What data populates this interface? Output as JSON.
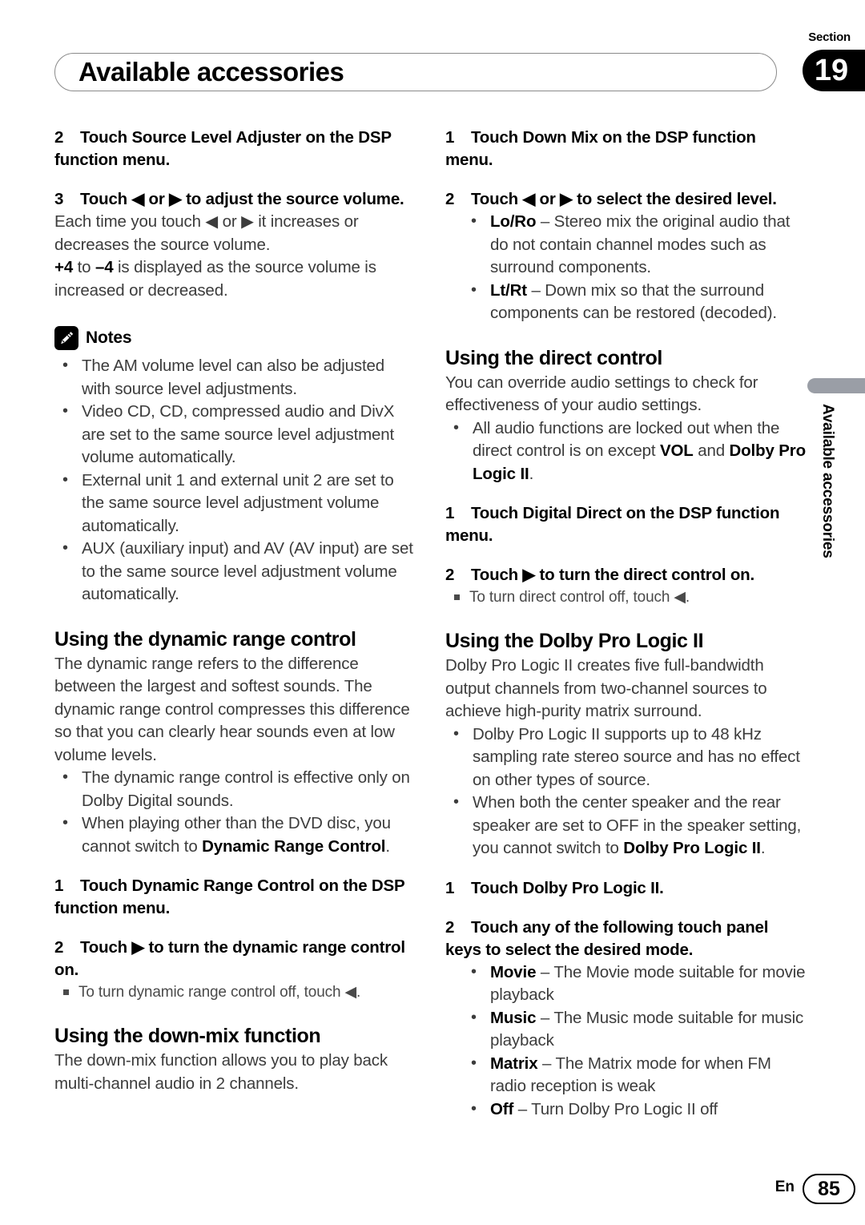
{
  "header": {
    "section_word": "Section",
    "section_number": "19",
    "title": "Available accessories"
  },
  "side_tab": {
    "label": "Available accessories"
  },
  "left_column": {
    "step_2_source_level": {
      "num": "2",
      "text": "Touch Source Level Adjuster on the DSP function menu."
    },
    "step_3_volume": {
      "num": "3",
      "text": "Touch ◀ or ▶ to adjust the source volume."
    },
    "step_3_body_1": "Each time you touch ◀ or ▶ it increases or decreases the source volume.",
    "step_3_body_2_prefix": "+4",
    "step_3_body_2_mid": " to ",
    "step_3_body_2_bold2": "–4",
    "step_3_body_2_suffix": " is displayed as the source volume is increased or decreased.",
    "notes_title": "Notes",
    "notes": [
      "The AM volume level can also be adjusted with source level adjustments.",
      "Video CD, CD, compressed audio and DivX are set to the same source level adjustment volume automatically.",
      "External unit 1 and external unit 2 are set to the same source level adjustment volume automatically.",
      "AUX (auxiliary input) and AV (AV input) are set to the same source level adjustment volume automatically."
    ],
    "dynamic_range": {
      "heading": "Using the dynamic range control",
      "intro": "The dynamic range refers to the difference between the largest and softest sounds. The dynamic range control compresses this difference so that you can clearly hear sounds even at low volume levels.",
      "bullets": [
        {
          "text": "The dynamic range control is effective only on Dolby Digital sounds."
        },
        {
          "pre": "When playing other than the DVD disc, you cannot switch to ",
          "bold": "Dynamic Range Control",
          "post": "."
        }
      ],
      "step_1": {
        "num": "1",
        "text": "Touch Dynamic Range Control on the DSP function menu."
      },
      "step_2": {
        "num": "2",
        "text": "Touch ▶ to turn the dynamic range control on."
      },
      "step_2_note": "To turn dynamic range control off, touch ◀."
    },
    "down_mix": {
      "heading": "Using the down-mix function",
      "intro": "The down-mix function allows you to play back multi-channel audio in 2 channels."
    }
  },
  "right_column": {
    "step_1_down_mix": {
      "num": "1",
      "text": "Touch Down Mix on the DSP function menu."
    },
    "step_2_level": {
      "num": "2",
      "text": "Touch ◀ or ▶ to select the desired level."
    },
    "level_bullets": [
      {
        "bold": "Lo/Ro",
        "dash": " – ",
        "text": "Stereo mix the original audio that do not contain channel modes such as surround components."
      },
      {
        "bold": "Lt/Rt",
        "dash": " – ",
        "text": "Down mix so that the surround components can be restored (decoded)."
      }
    ],
    "direct_control": {
      "heading": "Using the direct control",
      "intro": "You can override audio settings to check for effectiveness of your audio settings.",
      "bullet_pre": "All audio functions are locked out when the direct control is on except ",
      "bullet_bold1": "VOL",
      "bullet_mid": " and ",
      "bullet_bold2": "Dolby Pro Logic II",
      "bullet_post": ".",
      "step_1": {
        "num": "1",
        "text": "Touch Digital Direct on the DSP function menu."
      },
      "step_2": {
        "num": "2",
        "text": "Touch ▶ to turn the direct control on."
      },
      "step_2_note": "To turn direct control off, touch ◀."
    },
    "dolby": {
      "heading": "Using the Dolby Pro Logic II",
      "intro": "Dolby Pro Logic II creates five full-bandwidth output channels from two-channel sources to achieve high-purity matrix surround.",
      "bullets": [
        {
          "text": "Dolby Pro Logic II supports up to 48 kHz sampling rate stereo source and has no effect on other types of source."
        },
        {
          "pre": "When both the center speaker and the rear speaker are set to OFF in the speaker setting, you cannot switch to ",
          "bold": "Dolby Pro Logic II",
          "post": "."
        }
      ],
      "step_1": {
        "num": "1",
        "text": "Touch Dolby Pro Logic II."
      },
      "step_2": {
        "num": "2",
        "text": "Touch any of the following touch panel keys to select the desired mode."
      },
      "mode_bullets": [
        {
          "bold": "Movie",
          "dash": " – ",
          "text": "The Movie mode suitable for movie playback"
        },
        {
          "bold": "Music",
          "dash": " – ",
          "text": "The Music mode suitable for music playback"
        },
        {
          "bold": "Matrix",
          "dash": " – ",
          "text": "The Matrix mode for when FM radio reception is weak"
        },
        {
          "bold": "Off",
          "dash": " – ",
          "text": "Turn Dolby Pro Logic II off"
        }
      ]
    }
  },
  "footer": {
    "language": "En",
    "page_number": "85"
  }
}
